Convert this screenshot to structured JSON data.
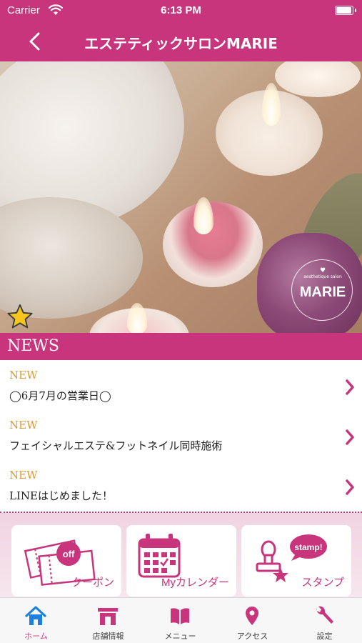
{
  "status_bar": {
    "carrier": "Carrier",
    "time": "6:13 PM",
    "battery_level": 1.0
  },
  "nav": {
    "title": "エステティックサロンMARIE",
    "back_icon": "chevron-left-icon"
  },
  "hero": {
    "logo_small": "aesthetique salon",
    "logo_text": "MARIE",
    "favorite_icon": "star-icon"
  },
  "news": {
    "title": "NEWS",
    "items": [
      {
        "badge": "NEW",
        "text": "◯6月7月の営業日◯"
      },
      {
        "badge": "NEW",
        "text": "フェイシャルエステ&フットネイル同時施術"
      },
      {
        "badge": "NEW",
        "text": "LINEはじめました！"
      }
    ]
  },
  "menu": {
    "tiles": [
      {
        "label": "クーポン",
        "icon": "coupon-icon",
        "icon_text": "off"
      },
      {
        "label": "Myカレンダー",
        "icon": "calendar-icon"
      },
      {
        "label": "スタンプ",
        "icon": "stamp-icon",
        "icon_text": "stamp!"
      }
    ]
  },
  "tabs": [
    {
      "label": "ホーム",
      "icon": "home-icon",
      "active": true
    },
    {
      "label": "店舗情報",
      "icon": "store-icon",
      "active": false
    },
    {
      "label": "メニュー",
      "icon": "book-icon",
      "active": false
    },
    {
      "label": "アクセス",
      "icon": "location-pin-icon",
      "active": false
    },
    {
      "label": "設定",
      "icon": "wrench-icon",
      "active": false
    }
  ],
  "colors": {
    "brand": "#c8357c",
    "new_badge": "#e49a2c",
    "tab_active": "#d8408c",
    "tab_inactive": "#c8357c"
  }
}
